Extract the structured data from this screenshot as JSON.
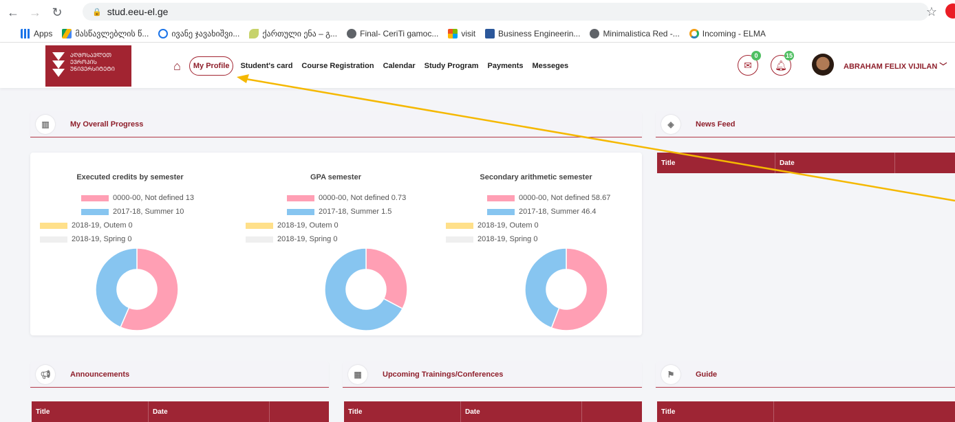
{
  "browser": {
    "url": "stud.eeu-el.ge",
    "bookmarks": [
      "Apps",
      "მასწავლებლის წ...",
      "ივანე ჯავახიშვი...",
      "ქართული ენა – გ...",
      "Final- CeriTi gamoc...",
      "visit",
      "Business Engineerin...",
      "Minimalistica Red -...",
      "Incoming - ELMA"
    ]
  },
  "header": {
    "logo_lines": [
      "ᲐᲦᲛᲝᲡᲐᲕᲚᲔᲗ",
      "ᲔᲕᲠᲝᲞᲘᲡ",
      "ᲣᲜᲘᲕᲔᲠᲡᲘᲢᲔᲢᲘ"
    ],
    "nav": [
      "My Profile",
      "Student's card",
      "Course Registration",
      "Calendar",
      "Study Program",
      "Payments",
      "Messeges"
    ],
    "mail_count": "0",
    "notif_count": "15",
    "user_name": "ABRAHAM FELIX VIJILAN"
  },
  "panels": {
    "progress": "My Overall Progress",
    "news": "News Feed",
    "announcements": "Announcements",
    "trainings": "Upcoming Trainings/Conferences",
    "guide": "Guide"
  },
  "table": {
    "title": "Title",
    "date": "Date"
  },
  "colors": {
    "pink": "#ff9fb4",
    "blue": "#87c5f0",
    "yellow": "#ffe08a",
    "grey": "#efefef",
    "brand": "#9e2534"
  },
  "chart_data": [
    {
      "type": "pie",
      "title": "Executed credits by semester",
      "categories": [
        "0000-00, Not defined",
        "2017-18, Summer",
        "2018-19, Outem",
        "2018-19, Spring"
      ],
      "values": [
        13,
        10,
        0,
        0
      ],
      "legend_labels": [
        "0000-00, Not defined 13",
        "2017-18, Summer 10",
        "2018-19, Outem 0",
        "2018-19, Spring 0"
      ]
    },
    {
      "type": "pie",
      "title": "GPA semester",
      "categories": [
        "0000-00, Not defined",
        "2017-18, Summer",
        "2018-19, Outem",
        "2018-19, Spring"
      ],
      "values": [
        0.73,
        1.5,
        0,
        0
      ],
      "legend_labels": [
        "0000-00, Not defined 0.73",
        "2017-18, Summer 1.5",
        "2018-19, Outem 0",
        "2018-19, Spring 0"
      ]
    },
    {
      "type": "pie",
      "title": "Secondary arithmetic semester",
      "categories": [
        "0000-00, Not defined",
        "2017-18, Summer",
        "2018-19, Outem",
        "2018-19, Spring"
      ],
      "values": [
        58.67,
        46.4,
        0,
        0
      ],
      "legend_labels": [
        "0000-00, Not defined 58.67",
        "2017-18, Summer 46.4",
        "2018-19, Outem 0",
        "2018-19, Spring 0"
      ]
    }
  ]
}
